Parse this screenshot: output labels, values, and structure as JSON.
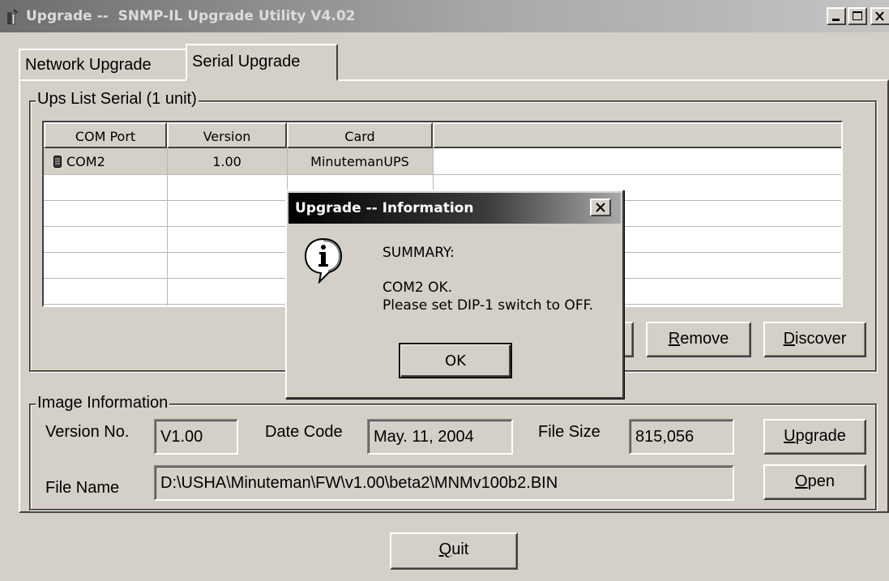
{
  "window": {
    "title": "Upgrade --  SNMP-IL Upgrade Utility V4.02"
  },
  "tabs": [
    {
      "label": "Network Upgrade",
      "selected": false
    },
    {
      "label": "Serial Upgrade",
      "selected": true
    }
  ],
  "ups_list": {
    "group_title": "Ups List Serial (1 unit)",
    "columns": [
      "COM Port",
      "Version",
      "Card",
      ""
    ],
    "rows": [
      {
        "icon": "serial-device-icon",
        "com_port": "COM2",
        "version": "1.00",
        "card": "MinutemanUPS"
      }
    ],
    "buttons": {
      "remove": {
        "prefix": "",
        "hotkey": "R",
        "rest": "emove"
      },
      "discover": {
        "prefix": "",
        "hotkey": "D",
        "rest": "iscover"
      }
    }
  },
  "image_info": {
    "group_title": "Image Information",
    "version_label": "Version No.",
    "version_value": "V1.00",
    "date_label": "Date Code",
    "date_value": "May. 11, 2004",
    "size_label": "File Size",
    "size_value": "815,056",
    "filename_label": "File Name",
    "filename_value": "D:\\USHA\\Minuteman\\FW\\v1.00\\beta2\\MNMv100b2.BIN",
    "buttons": {
      "upgrade": {
        "hotkey": "U",
        "rest": "pgrade"
      },
      "open": {
        "hotkey": "O",
        "rest": "pen"
      }
    }
  },
  "quit_button": {
    "hotkey": "Q",
    "rest": "uit"
  },
  "dialog": {
    "title": "Upgrade -- Information",
    "icon": "info-icon",
    "line1": "SUMMARY:",
    "line2": "COM2  OK.",
    "line3": "Please set DIP-1 switch to OFF.",
    "ok_label": "OK"
  }
}
